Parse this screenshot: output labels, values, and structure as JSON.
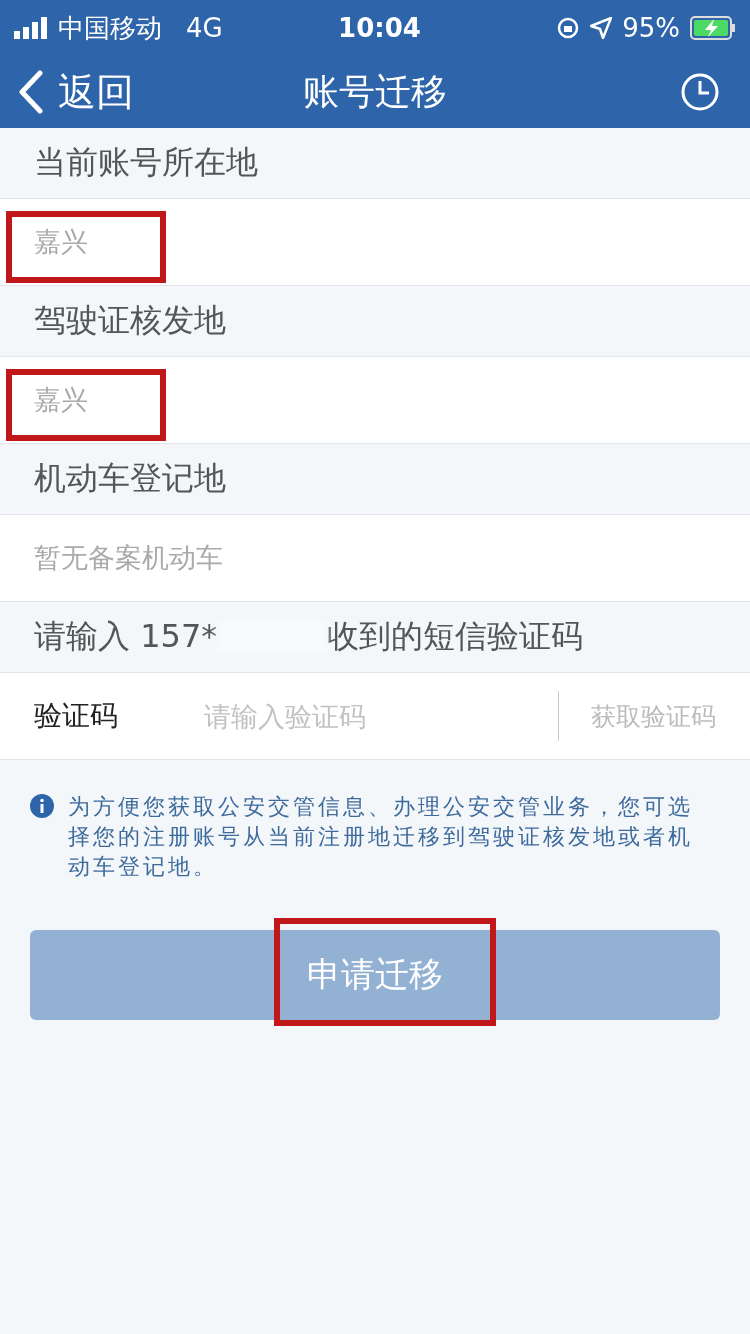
{
  "status_bar": {
    "carrier": "中国移动",
    "network": "4G",
    "time": "10:04",
    "battery": "95%"
  },
  "nav": {
    "back": "返回",
    "title": "账号迁移"
  },
  "sections": [
    {
      "label": "当前账号所在地",
      "value": "嘉兴",
      "highlighted": true
    },
    {
      "label": "驾驶证核发地",
      "value": "嘉兴",
      "highlighted": true
    },
    {
      "label": "机动车登记地",
      "value": "暂无备案机动车",
      "highlighted": false
    }
  ],
  "sms_prompt": {
    "before": "请输入 157*",
    "after": "收到的短信验证码"
  },
  "code_row": {
    "label": "验证码",
    "placeholder": "请输入验证码",
    "action": "获取验证码"
  },
  "info": "为方便您获取公安交管信息、办理公安交管业务，您可选择您的注册账号从当前注册地迁移到驾驶证核发地或者机动车登记地。",
  "submit": {
    "label": "申请迁移",
    "disabled": true,
    "highlighted": true
  }
}
